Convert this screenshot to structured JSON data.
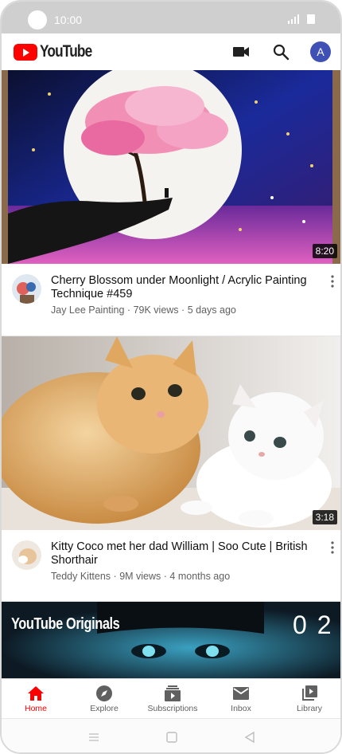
{
  "status_bar": {
    "time": "10:00"
  },
  "app": {
    "logo_text": "YouTube",
    "avatar_letter": "A",
    "accent_color": "#ff0000",
    "avatar_color": "#3f51b5"
  },
  "videos": [
    {
      "title": "Cherry Blossom under Moonlight / Acrylic Painting Technique #459",
      "channel": "Jay Lee Painting",
      "views": "79K views",
      "age": "5 days ago",
      "duration": "8:20"
    },
    {
      "title": "Kitty Coco met  her dad William | Soo Cute | British Shorthair",
      "channel": "Teddy Kittens",
      "views": "9M views",
      "age": "4 months ago",
      "duration": "3:18"
    },
    {
      "badge": "YouTube Originals",
      "episode": "0 2"
    }
  ],
  "bottom_nav": [
    {
      "label": "Home",
      "icon": "home-icon",
      "active": true
    },
    {
      "label": "Explore",
      "icon": "compass-icon",
      "active": false
    },
    {
      "label": "Subscriptions",
      "icon": "subscriptions-icon",
      "active": false
    },
    {
      "label": "Inbox",
      "icon": "mail-icon",
      "active": false
    },
    {
      "label": "Library",
      "icon": "library-icon",
      "active": false
    }
  ],
  "meta_separator": "·"
}
